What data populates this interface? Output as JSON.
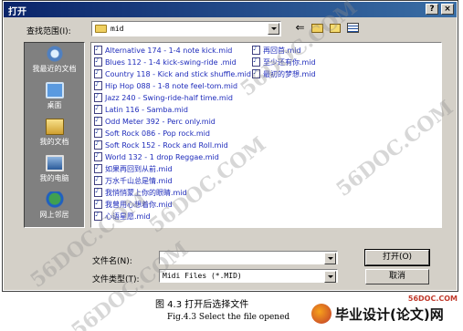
{
  "window": {
    "title": "打开",
    "help_label": "?",
    "close_label": "×"
  },
  "toolbar": {
    "look_in_label": "查找范围(I):",
    "look_in_value": "mid",
    "back_icon": "back-arrow-icon",
    "up_icon": "up-folder-icon",
    "new_folder_icon": "new-folder-icon",
    "view_icon": "view-menu-icon"
  },
  "places": [
    {
      "label": "我最近的文档",
      "icon": "recent-documents-icon"
    },
    {
      "label": "桌面",
      "icon": "desktop-icon"
    },
    {
      "label": "我的文档",
      "icon": "my-documents-icon"
    },
    {
      "label": "我的电脑",
      "icon": "my-computer-icon"
    },
    {
      "label": "网上邻居",
      "icon": "network-places-icon"
    }
  ],
  "files_col1": [
    "Alternative 174 - 1-4 note kick.mid",
    "Blues 112 - 1-4 kick-swing-ride .mid",
    "Country 118 - Kick and stick shuffle.mid",
    "Hip Hop 088 - 1-8 note feel-tom.mid",
    "Jazz 240 - Swing-ride-half time.mid",
    "Latin 116 - Samba.mid",
    "Odd Meter 392  - Perc only.mid",
    "Soft Rock 086 - Pop rock.mid",
    "Soft Rock 152 - Rock and Roll.mid",
    "World 132 - 1 drop Reggae.mid",
    "如果再回到从前.mid",
    "万水千山总是情.mid",
    "我悄悄蒙上你的眼睛.mid",
    "我曾用心想着你.mid",
    "心语星愿.mid"
  ],
  "files_col2": [
    "再回首.mid",
    "至少还有你.mid",
    "最初的梦想.mid"
  ],
  "filename": {
    "label": "文件名(N):",
    "value": ""
  },
  "filetype": {
    "label": "文件类型(T):",
    "value": "Midi Files (*.MID)"
  },
  "buttons": {
    "open": "打开(O)",
    "cancel": "取消"
  },
  "caption": {
    "cn": "图 4.3   打开后选择文件",
    "en": "Fig.4.3   Select the file opened"
  },
  "watermark": {
    "text1": "56DOC.COM",
    "text2": "56DOC.COM",
    "text3": "56DOC.COM",
    "text4": "56DOC.COM",
    "text5": "56DOC.COM"
  },
  "site": "56DOC.COM",
  "brand": "毕业设计(论文)网"
}
